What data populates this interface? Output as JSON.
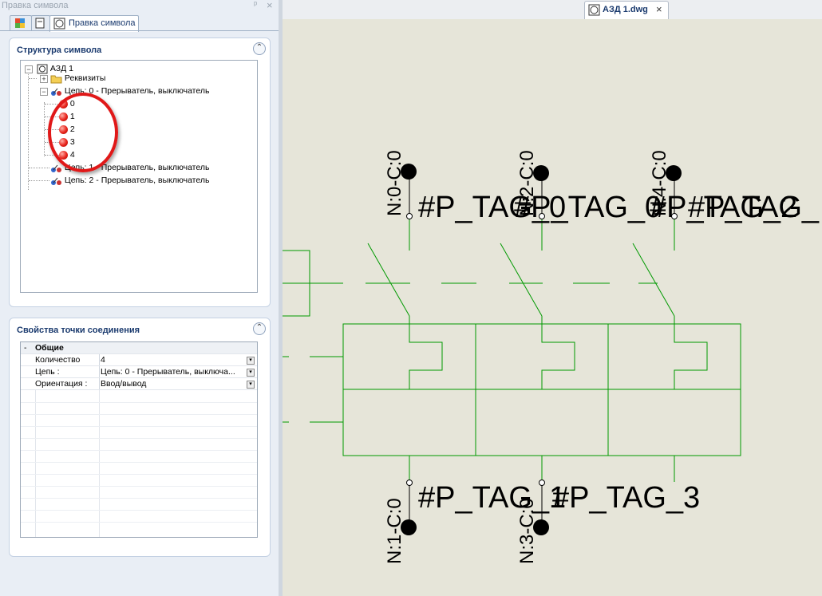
{
  "panel": {
    "title": "Правка символа",
    "tabs": [
      {
        "label": "Правка символа"
      }
    ]
  },
  "structure": {
    "header": "Структура символа",
    "root": "АЗД 1",
    "props_node": "Реквизиты",
    "circuits": [
      "Цепь: 0 - Прерыватель, выключатель",
      "Цепь: 1 - Прерыватель, выключатель",
      "Цепь: 2 - Прерыватель, выключатель"
    ],
    "points": [
      "0",
      "1",
      "2",
      "3",
      "4"
    ]
  },
  "properties": {
    "header": "Свойства точки соединения",
    "group": "Общие",
    "rows": [
      {
        "label": "Количество",
        "value": "4"
      },
      {
        "label": "Цепь :",
        "value": "Цепь: 0 - Прерыватель, выключа..."
      },
      {
        "label": "Ориентация :",
        "value": "Ввод/вывод"
      }
    ]
  },
  "document": {
    "tab_label": "АЗД 1.dwg"
  },
  "drawing": {
    "top_pins": [
      "N:0-C:0",
      "N:2-C:0",
      "N:4-C:0"
    ],
    "top_tags": [
      "#P_TAG_0",
      "#P_TAG_0",
      "#P_TAG_2",
      "#P_TAG_"
    ],
    "bottom_pins": [
      "N:1-C:0",
      "N:3-C:0"
    ],
    "bottom_tags": [
      "#P_TAG_1",
      "#P_TAG_3"
    ],
    "line_color": "#009900"
  },
  "colors": {
    "accent": "#1a3a6e",
    "highlight": "#e01818",
    "canvas": "#e6e5d9"
  }
}
